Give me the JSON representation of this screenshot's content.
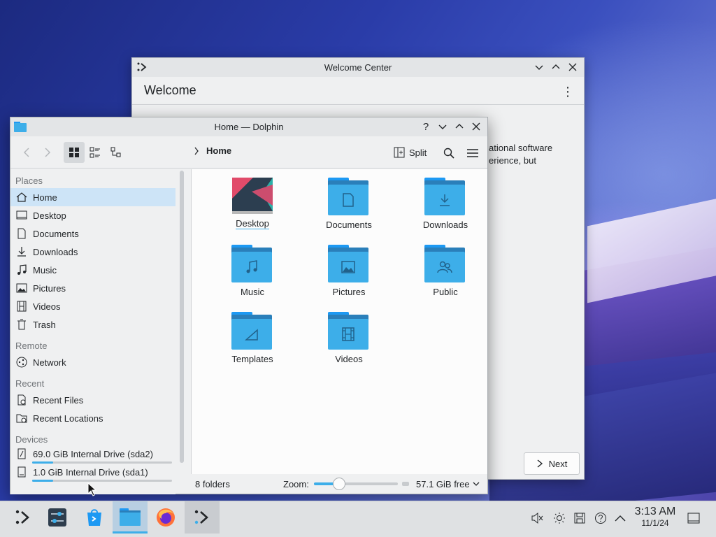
{
  "welcome_window": {
    "title": "Welcome Center",
    "header": "Welcome",
    "body_line1": "ational software",
    "body_line2": "erience, but",
    "next_label": "Next"
  },
  "dolphin": {
    "title": "Home — Dolphin",
    "breadcrumb": "Home",
    "split_label": "Split",
    "places": {
      "section_places": "Places",
      "home": "Home",
      "desktop": "Desktop",
      "documents": "Documents",
      "downloads": "Downloads",
      "music": "Music",
      "pictures": "Pictures",
      "videos": "Videos",
      "trash": "Trash",
      "section_remote": "Remote",
      "network": "Network",
      "section_recent": "Recent",
      "recent_files": "Recent Files",
      "recent_locations": "Recent Locations",
      "section_devices": "Devices",
      "drive1": "69.0 GiB Internal Drive (sda2)",
      "drive1_used": 0.15,
      "drive2": "1.0 GiB Internal Drive (sda1)",
      "drive2_used": 0.15
    },
    "files": {
      "desktop": "Desktop",
      "documents": "Documents",
      "downloads": "Downloads",
      "music": "Music",
      "pictures": "Pictures",
      "public": "Public",
      "templates": "Templates",
      "videos": "Videos"
    },
    "status": {
      "count": "8 folders",
      "zoom_label": "Zoom:",
      "zoom_level": 0.3,
      "free_space": "57.1 GiB free"
    }
  },
  "taskbar": {
    "time": "3:13 AM",
    "date": "11/1/24"
  },
  "colors": {
    "accent": "#3daee9",
    "selection": "#cde4f7"
  }
}
